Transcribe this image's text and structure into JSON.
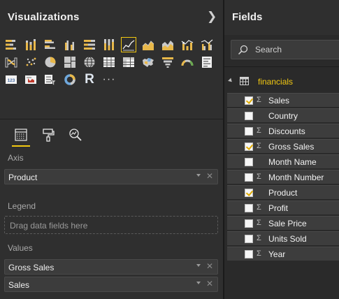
{
  "visualizations": {
    "title": "Visualizations",
    "icons": [
      [
        "stacked-bar-chart-icon",
        "stacked-column-chart-icon",
        "clustered-bar-chart-icon",
        "clustered-column-chart-icon",
        "100-stacked-bar-chart-icon",
        "100-stacked-column-chart-icon",
        "line-chart-icon",
        "area-chart-icon",
        "stacked-area-chart-icon",
        "line-and-stacked-column-icon",
        "line-and-clustered-column-icon"
      ],
      [
        "ribbon-chart-icon",
        "scatter-chart-icon",
        "pie-chart-icon",
        "treemap-icon",
        "globe-map-icon",
        "table-icon",
        "matrix-icon",
        "filled-map-icon",
        "funnel-icon",
        "gauge-icon",
        "multi-row-card-icon"
      ],
      [
        "card-icon",
        "kpi-icon",
        "slicer-icon",
        "donut-chart-icon",
        "r-visual-icon",
        "more-visuals-icon"
      ]
    ],
    "selected_icon": "line-chart-icon",
    "r_letter": "R",
    "more_dots": "···",
    "tabs": [
      "fields-tab",
      "format-tab",
      "analytics-tab"
    ],
    "active_tab": "fields-tab",
    "axis": {
      "label": "Axis",
      "field": "Product"
    },
    "legend": {
      "label": "Legend",
      "placeholder": "Drag data fields here"
    },
    "values": {
      "label": "Values",
      "fields": [
        "Gross Sales",
        "Sales"
      ]
    },
    "accent": "#f2c811"
  },
  "fields": {
    "title": "Fields",
    "search_placeholder": "Search",
    "table_name": "financials",
    "items": [
      {
        "label": "Sales",
        "checked": true,
        "sigma": true
      },
      {
        "label": "Country",
        "checked": false,
        "sigma": false
      },
      {
        "label": "Discounts",
        "checked": false,
        "sigma": true
      },
      {
        "label": "Gross Sales",
        "checked": true,
        "sigma": true
      },
      {
        "label": "Month Name",
        "checked": false,
        "sigma": false
      },
      {
        "label": "Month Number",
        "checked": false,
        "sigma": true
      },
      {
        "label": "Product",
        "checked": true,
        "sigma": false
      },
      {
        "label": "Profit",
        "checked": false,
        "sigma": true
      },
      {
        "label": "Sale Price",
        "checked": false,
        "sigma": true
      },
      {
        "label": "Units Sold",
        "checked": false,
        "sigma": true
      },
      {
        "label": "Year",
        "checked": false,
        "sigma": true
      }
    ]
  }
}
